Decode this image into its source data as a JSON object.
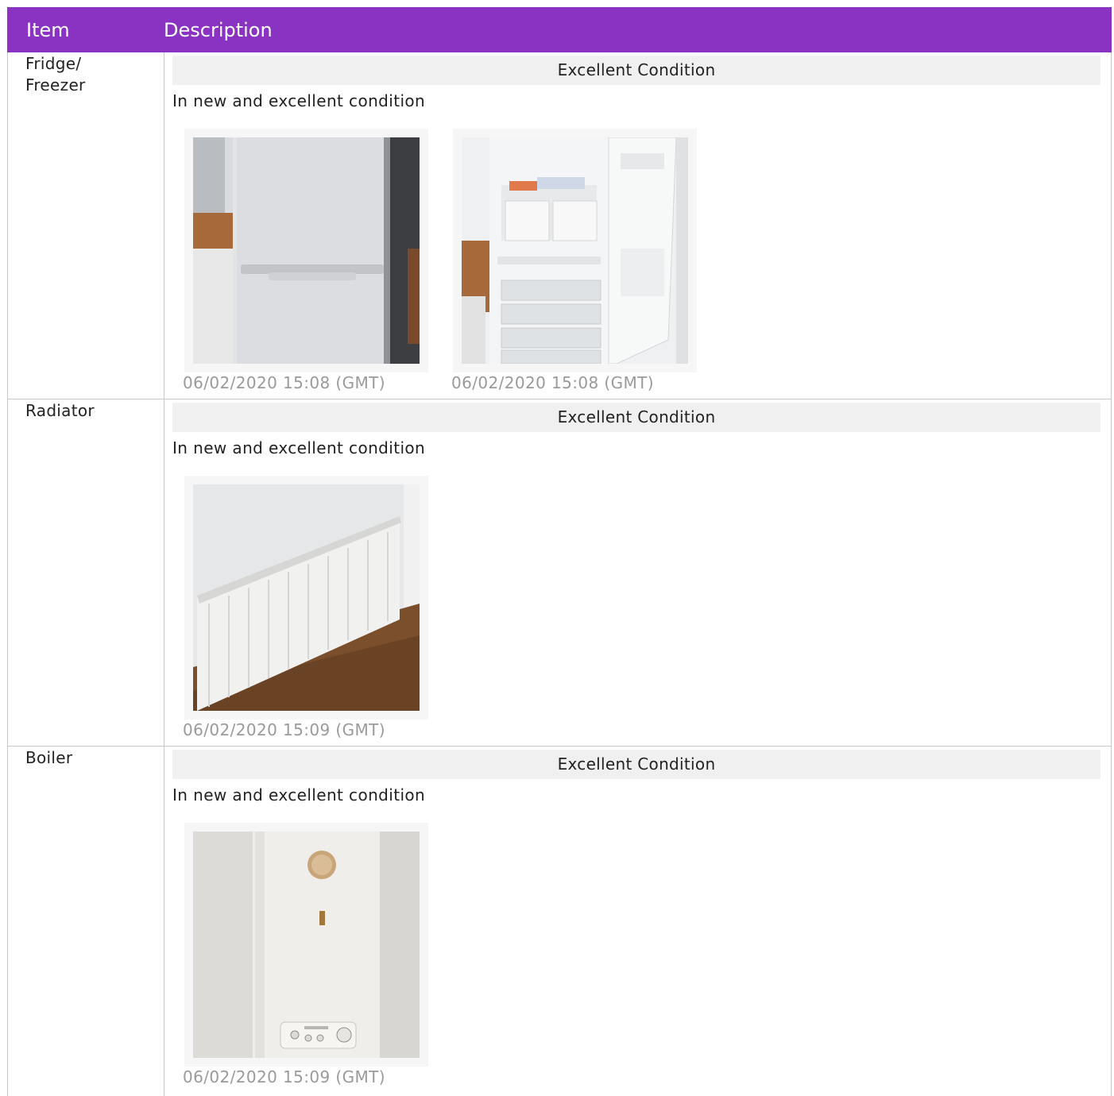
{
  "table": {
    "header_item": "Item",
    "header_description": "Description"
  },
  "rows": [
    {
      "item": "Fridge/ Freezer",
      "item_line1": "Fridge/",
      "item_line2": "Freezer",
      "condition": "Excellent Condition",
      "description": "In new and excellent condition",
      "photos": [
        {
          "timestamp": "06/02/2020 15:08 (GMT)",
          "subject": "fridge-freezer-closed"
        },
        {
          "timestamp": "06/02/2020 15:08 (GMT)",
          "subject": "fridge-freezer-open"
        }
      ]
    },
    {
      "item": "Radiator",
      "condition": "Excellent Condition",
      "description": "In new and excellent condition",
      "photos": [
        {
          "timestamp": "06/02/2020 15:09 (GMT)",
          "subject": "radiator"
        }
      ]
    },
    {
      "item": "Boiler",
      "condition": "Excellent Condition",
      "description": "In new and excellent condition",
      "photos": [
        {
          "timestamp": "06/02/2020 15:09 (GMT)",
          "subject": "boiler"
        }
      ]
    }
  ],
  "colors": {
    "header_bg": "#8a33c2",
    "condition_bar_bg": "#f0f0f0",
    "timestamp_text": "#9a9a9a"
  }
}
